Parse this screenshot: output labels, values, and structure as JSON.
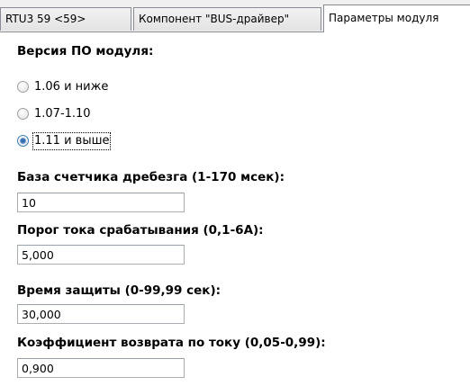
{
  "tabs": [
    {
      "label": "RTU3 59 <59>"
    },
    {
      "label": "Компонент \"BUS-драйвер\""
    },
    {
      "label": "Параметры модуля",
      "active": true
    }
  ],
  "firmware": {
    "title": "Версия ПО модуля:",
    "options": [
      {
        "label": "1.06 и ниже",
        "selected": false
      },
      {
        "label": "1.07-1.10",
        "selected": false
      },
      {
        "label": "1.11 и выше",
        "selected": true
      }
    ]
  },
  "fields": [
    {
      "label": "База счетчика дребезга (1-170 мсек):",
      "value": "10"
    },
    {
      "label": "Порог тока срабатывания (0,1-6А):",
      "value": "5,000"
    },
    {
      "label": "Время защиты (0-99,99 сек):",
      "value": "30,000"
    },
    {
      "label": "Коэффициент возврата по току (0,05-0,99):",
      "value": "0,900"
    }
  ],
  "colors": {
    "tab_border": "#898c95",
    "tab_bg": "#e9e9e9",
    "input_border": "#abadb3",
    "radio_accent": "#3a6fae"
  }
}
